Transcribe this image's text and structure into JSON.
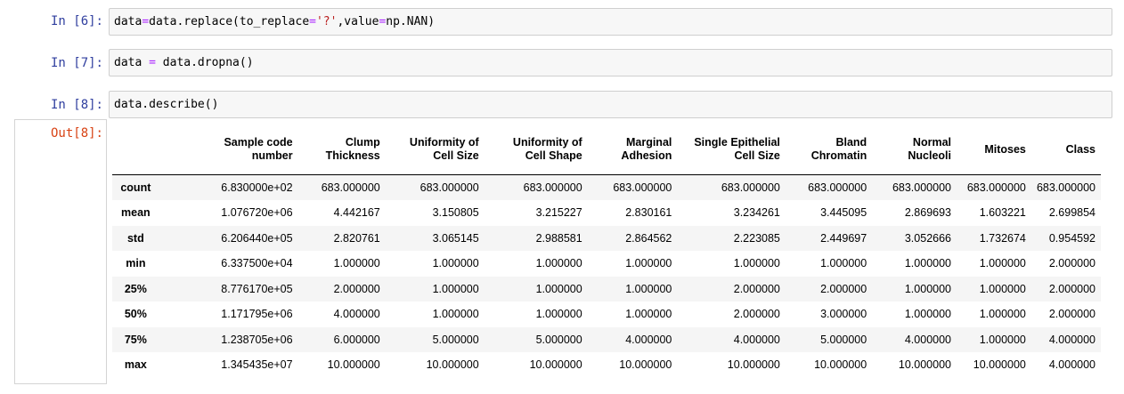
{
  "cells": [
    {
      "prompt": "In  [6]:",
      "code": [
        {
          "t": "data",
          "c": ""
        },
        {
          "t": "=",
          "c": "t-op"
        },
        {
          "t": "data.replace(to_replace",
          "c": ""
        },
        {
          "t": "=",
          "c": "t-op"
        },
        {
          "t": "'?'",
          "c": "t-str"
        },
        {
          "t": ",value",
          "c": ""
        },
        {
          "t": "=",
          "c": "t-op"
        },
        {
          "t": "np.NAN)",
          "c": ""
        }
      ]
    },
    {
      "prompt": "In  [7]:",
      "code": [
        {
          "t": "data ",
          "c": ""
        },
        {
          "t": "=",
          "c": "t-op"
        },
        {
          "t": " data.dropna()",
          "c": ""
        }
      ]
    },
    {
      "prompt": "In  [8]:",
      "code": [
        {
          "t": "data.describe()",
          "c": ""
        }
      ]
    }
  ],
  "output": {
    "prompt": "Out[8]:",
    "columns": [
      [
        "Sample code",
        "number"
      ],
      [
        "Clump",
        "Thickness"
      ],
      [
        "Uniformity of",
        "Cell Size"
      ],
      [
        "Uniformity of",
        "Cell Shape"
      ],
      [
        "Marginal",
        "Adhesion"
      ],
      [
        "Single Epithelial",
        "Cell Size"
      ],
      [
        "Bland",
        "Chromatin"
      ],
      [
        "Normal",
        "Nucleoli"
      ],
      [
        "Mitoses"
      ],
      [
        "Class"
      ]
    ],
    "rows": [
      {
        "index": "count",
        "values": [
          "6.830000e+02",
          "683.000000",
          "683.000000",
          "683.000000",
          "683.000000",
          "683.000000",
          "683.000000",
          "683.000000",
          "683.000000",
          "683.000000"
        ]
      },
      {
        "index": "mean",
        "values": [
          "1.076720e+06",
          "4.442167",
          "3.150805",
          "3.215227",
          "2.830161",
          "3.234261",
          "3.445095",
          "2.869693",
          "1.603221",
          "2.699854"
        ]
      },
      {
        "index": "std",
        "values": [
          "6.206440e+05",
          "2.820761",
          "3.065145",
          "2.988581",
          "2.864562",
          "2.223085",
          "2.449697",
          "3.052666",
          "1.732674",
          "0.954592"
        ]
      },
      {
        "index": "min",
        "values": [
          "6.337500e+04",
          "1.000000",
          "1.000000",
          "1.000000",
          "1.000000",
          "1.000000",
          "1.000000",
          "1.000000",
          "1.000000",
          "2.000000"
        ]
      },
      {
        "index": "25%",
        "values": [
          "8.776170e+05",
          "2.000000",
          "1.000000",
          "1.000000",
          "1.000000",
          "2.000000",
          "2.000000",
          "1.000000",
          "1.000000",
          "2.000000"
        ]
      },
      {
        "index": "50%",
        "values": [
          "1.171795e+06",
          "4.000000",
          "1.000000",
          "1.000000",
          "1.000000",
          "2.000000",
          "3.000000",
          "1.000000",
          "1.000000",
          "2.000000"
        ]
      },
      {
        "index": "75%",
        "values": [
          "1.238705e+06",
          "6.000000",
          "5.000000",
          "5.000000",
          "4.000000",
          "4.000000",
          "5.000000",
          "4.000000",
          "1.000000",
          "4.000000"
        ]
      },
      {
        "index": "max",
        "values": [
          "1.345435e+07",
          "10.000000",
          "10.000000",
          "10.000000",
          "10.000000",
          "10.000000",
          "10.000000",
          "10.000000",
          "10.000000",
          "4.000000"
        ]
      }
    ]
  }
}
